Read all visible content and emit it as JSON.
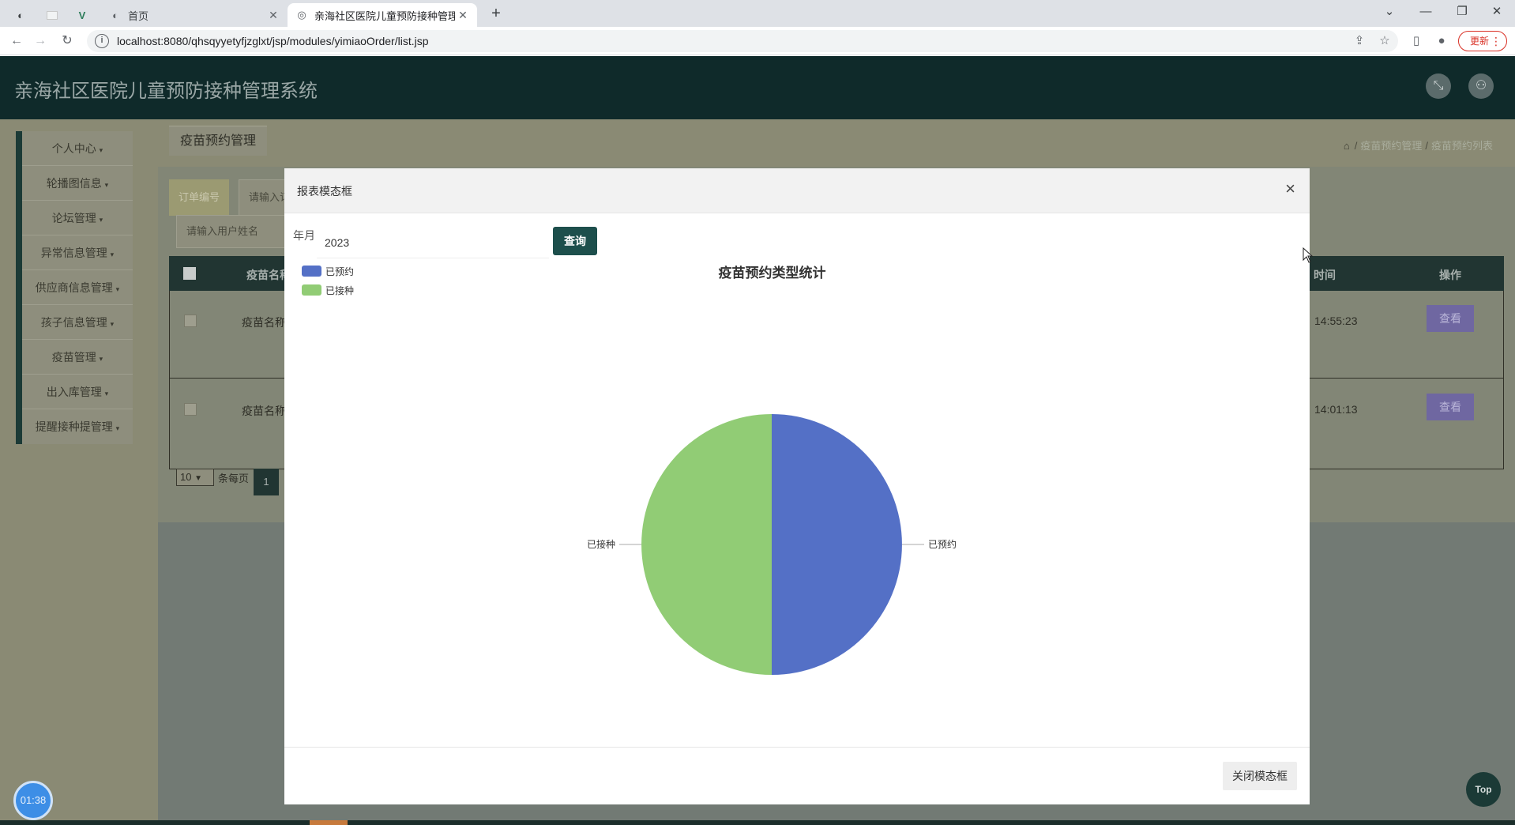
{
  "browser": {
    "tabs": [
      {
        "label": "首页"
      },
      {
        "label": "亲海社区医院儿童预防接种管理系统"
      }
    ],
    "url": "localhost:8080/qhsqyyetyfjzglxt/jsp/modules/yimiaoOrder/list.jsp",
    "update_label": "更新"
  },
  "app": {
    "title": "亲海社区医院儿童预防接种管理系统",
    "sidebar": [
      {
        "label": "个人中心"
      },
      {
        "label": "轮播图信息"
      },
      {
        "label": "论坛管理"
      },
      {
        "label": "异常信息管理"
      },
      {
        "label": "供应商信息管理"
      },
      {
        "label": "孩子信息管理"
      },
      {
        "label": "疫苗管理"
      },
      {
        "label": "出入库管理"
      },
      {
        "label": "提醒接种提管理"
      }
    ],
    "page_title": "疫苗预约管理",
    "breadcrumb": [
      "疫苗预约管理",
      "疫苗预约列表"
    ],
    "filter": {
      "order_no_label": "订单编号",
      "order_no_placeholder": "请输入订",
      "username_placeholder": "请输入用户姓名"
    },
    "table": {
      "headers": [
        "疫苗名称",
        "时间",
        "操作"
      ],
      "rows": [
        {
          "name": "疫苗名称",
          "time": "14:55:23",
          "action": "查看"
        },
        {
          "name": "疫苗名称",
          "time": "14:01:13",
          "action": "查看"
        }
      ]
    },
    "pager": {
      "size": "10",
      "size_label": "条每页",
      "page": "1"
    },
    "timer": "01:38",
    "top_label": "Top"
  },
  "modal": {
    "title": "报表模态框",
    "year_label": "年月",
    "year_value": "2023",
    "query_label": "查询",
    "close_label": "关闭模态框"
  },
  "chart_data": {
    "type": "pie",
    "title": "疫苗预约类型统计",
    "legend_position": "top-left",
    "categories": [
      "已预约",
      "已接种"
    ],
    "values": [
      1,
      1
    ],
    "colors": [
      "#5470c6",
      "#91cc75"
    ]
  }
}
